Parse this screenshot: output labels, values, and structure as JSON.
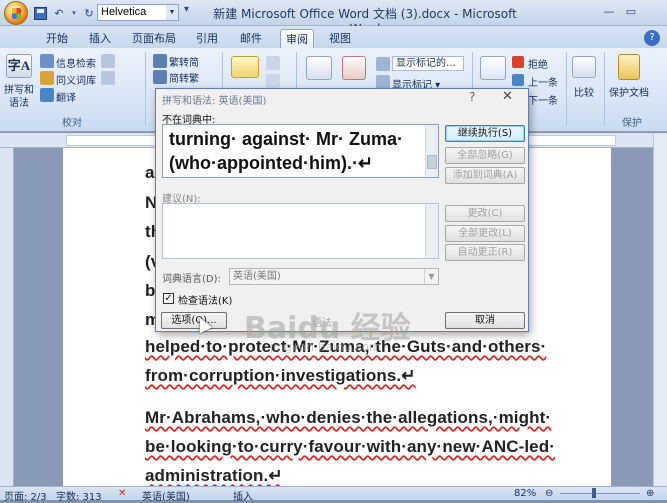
{
  "window": {
    "title": "新建 Microsoft Office Word 文档 (3).docx - Microsoft Word",
    "font_name": "Helvetica"
  },
  "tabs": [
    "开始",
    "插入",
    "页面布局",
    "引用",
    "邮件",
    "审阅",
    "视图"
  ],
  "active_tab": "审阅",
  "ribbon": {
    "proofing": {
      "big_label_1": "拼写和",
      "big_label_2": "语法",
      "research": "信息检索",
      "thesaurus": "同义词库",
      "translate": "翻译",
      "group_label": "校对"
    },
    "chinese": {
      "trad": "繁转简",
      "simp": "简转繁"
    },
    "tracking": {
      "show_markup_combo": "显示标记的…",
      "show_markup": "显示标记 ▾"
    },
    "changes": {
      "reject": "拒绝",
      "previous": "上一条",
      "next": "下一条"
    },
    "compare": "比较",
    "protect": {
      "label": "保护文档",
      "group_label": "保护"
    }
  },
  "document": {
    "lines": [
      "a",
      "N",
      "th",
      "(v",
      "b",
      "m",
      "helped·to·protect·Mr·Zuma,·the·Guts·and·others·",
      "from·corruption·investigations.↵",
      "Mr·Abrahams,·who·denies·the·allegations,·might·",
      "be·looking·to·curry·favour·with·any·new·ANC-led·",
      "administration.↵"
    ]
  },
  "dialog": {
    "title": "拼写和语法: 英语(美国)",
    "help": "?",
    "close": "✕",
    "not_in_dict_label": "不在词典中:",
    "text_line_1": "turning· against· Mr· Zuma·",
    "text_line_2": "(who·appointed·him).·↵",
    "suggestions_label": "建议(N):",
    "buttons": {
      "ignore_once": "继续执行(S)",
      "ignore_all": "全部忽略(G)",
      "add": "添加到词典(A)",
      "change": "更改(C)",
      "change_all": "全部更改(L)",
      "autocorrect": "自动更正(R)",
      "options": "选项(O)...",
      "cancel": "取消"
    },
    "dict_lang_label": "词典语言(D):",
    "dict_lang_value": "英语(美国)",
    "check_grammar_label": "检查语法(K)",
    "check_grammar_checked": true,
    "grammar_hint": "语法"
  },
  "statusbar": {
    "page": "页面: 2/3",
    "words": "字数: 313",
    "language": "英语(美国)",
    "mode": "插入",
    "zoom": "82%"
  },
  "watermark": {
    "brand": "Baidu 经验",
    "url": "jingyan.baidu.com"
  }
}
